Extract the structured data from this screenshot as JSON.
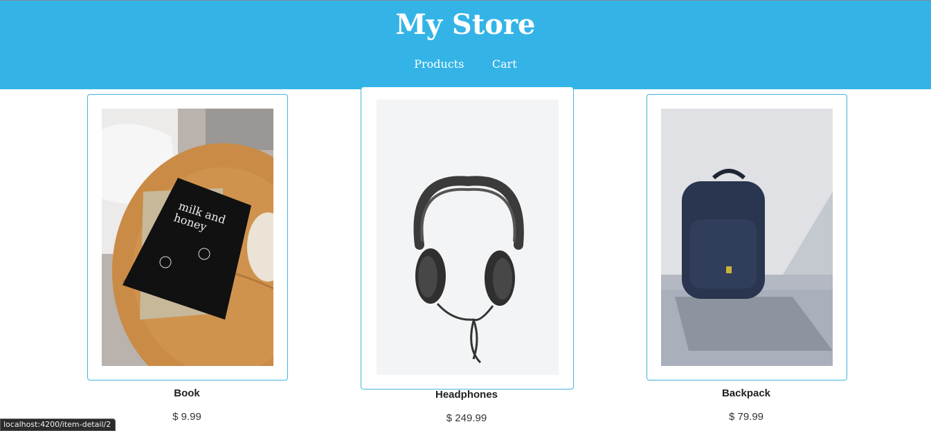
{
  "header": {
    "title": "My Store",
    "nav": [
      {
        "label": "Products"
      },
      {
        "label": "Cart"
      }
    ]
  },
  "products": [
    {
      "name": "Book",
      "price": "$ 9.99",
      "image": "book-photo"
    },
    {
      "name": "Headphones",
      "price": "$ 249.99",
      "image": "headphones-photo"
    },
    {
      "name": "Backpack",
      "price": "$ 79.99",
      "image": "backpack-photo"
    }
  ],
  "status_bar": {
    "url": "localhost:4200/item-detail/2"
  },
  "colors": {
    "header_bg": "#34b4e6",
    "card_border": "#3fb3df"
  }
}
